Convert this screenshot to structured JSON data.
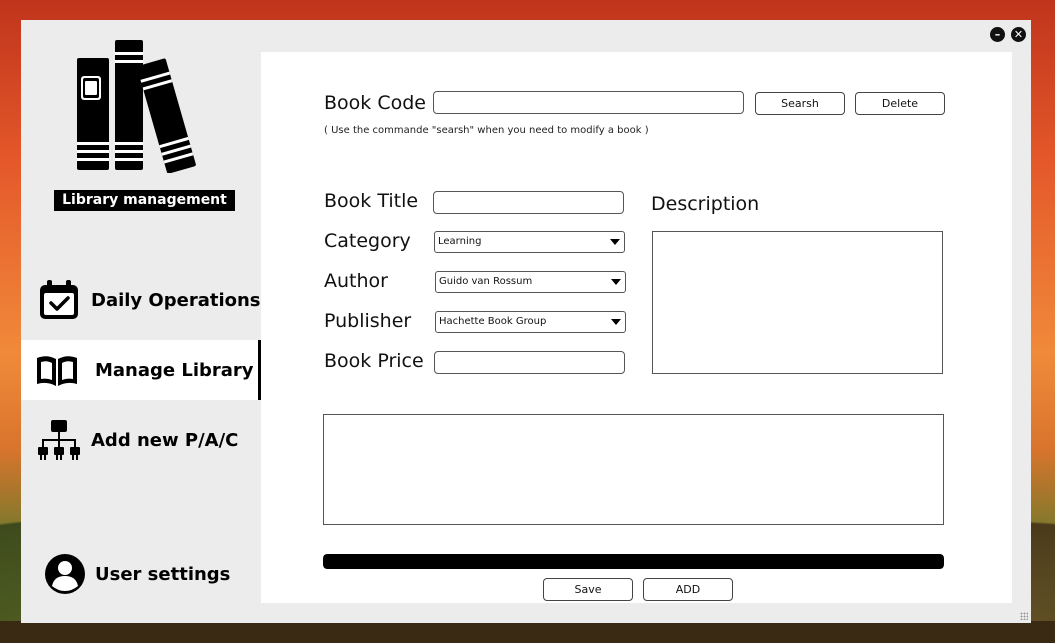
{
  "window": {
    "minimize_glyph": "–",
    "close_glyph": "✕"
  },
  "sidebar": {
    "app_title": "Library management",
    "logo_icon": "books-icon",
    "items": [
      {
        "label": "Daily Operations",
        "icon": "calendar-check-icon",
        "active": false
      },
      {
        "label": "Manage Library",
        "icon": "open-book-icon",
        "active": true
      },
      {
        "label": "Add new P/A/C",
        "icon": "sitemap-icon",
        "active": false
      }
    ],
    "user": {
      "label": "User settings",
      "icon": "user-circle-icon"
    }
  },
  "form": {
    "book_code_label": "Book Code",
    "book_code_value": "",
    "search_button": "Searsh",
    "delete_button": "Delete",
    "hint": "( Use the commande \"searsh\" when you need to modify a book )",
    "book_title_label": "Book Title",
    "book_title_value": "",
    "category_label": "Category",
    "category_value": "Learning",
    "author_label": "Author",
    "author_value": "Guido van Rossum",
    "publisher_label": "Publisher",
    "publisher_value": "Hachette Book Group",
    "book_price_label": "Book Price",
    "book_price_value": "",
    "description_label": "Description",
    "progress_fraction": 1.0,
    "save_button": "Save",
    "add_button": "ADD"
  },
  "colors": {
    "accent": "#000000",
    "panel_bg": "#ffffff",
    "window_bg": "#ececec"
  }
}
